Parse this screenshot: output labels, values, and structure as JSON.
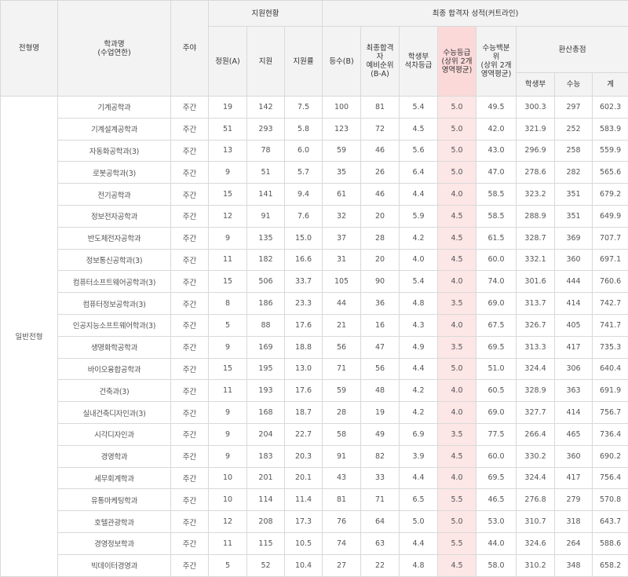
{
  "headers": {
    "type": "전형명",
    "major": "학과명\n(수업연한)",
    "schedule": "주야",
    "apply_group": "지원현황",
    "result_group": "최종 합격자 성적(커트라인)",
    "quota": "정원(A)",
    "applicants": "지원",
    "ratio": "지원률",
    "rank": "등수(B)",
    "waitlist": "최종합격\n자\n예비순위\n(B-A)",
    "school_grade": "학생부\n석차등급",
    "csat_grade": "수능등급\n(상위 2개\n영역평균)",
    "csat_pct": "수능백분\n위\n(상위 2개\n영역평균)",
    "conv_group": "환산총점",
    "conv_school": "학생부",
    "conv_csat": "수능",
    "conv_total": "계"
  },
  "admission_type": "일반전형",
  "rows": [
    {
      "major": "기계공학과",
      "schedule": "주간",
      "quota": "19",
      "applicants": "142",
      "ratio": "7.5",
      "rank": "100",
      "waitlist": "81",
      "school_grade": "5.4",
      "csat_grade": "5.0",
      "csat_pct": "49.5",
      "conv_school": "300.3",
      "conv_csat": "297",
      "conv_total": "602.3"
    },
    {
      "major": "기계설계공학과",
      "schedule": "주간",
      "quota": "51",
      "applicants": "293",
      "ratio": "5.8",
      "rank": "123",
      "waitlist": "72",
      "school_grade": "4.5",
      "csat_grade": "5.0",
      "csat_pct": "42.0",
      "conv_school": "321.9",
      "conv_csat": "252",
      "conv_total": "583.9"
    },
    {
      "major": "자동화공학과(3)",
      "schedule": "주간",
      "quota": "13",
      "applicants": "78",
      "ratio": "6.0",
      "rank": "59",
      "waitlist": "46",
      "school_grade": "5.6",
      "csat_grade": "5.0",
      "csat_pct": "43.0",
      "conv_school": "296.9",
      "conv_csat": "258",
      "conv_total": "559.9"
    },
    {
      "major": "로봇공학과(3)",
      "schedule": "주간",
      "quota": "9",
      "applicants": "51",
      "ratio": "5.7",
      "rank": "35",
      "waitlist": "26",
      "school_grade": "6.4",
      "csat_grade": "5.0",
      "csat_pct": "47.0",
      "conv_school": "278.6",
      "conv_csat": "282",
      "conv_total": "565.6"
    },
    {
      "major": "전기공학과",
      "schedule": "주간",
      "quota": "15",
      "applicants": "141",
      "ratio": "9.4",
      "rank": "61",
      "waitlist": "46",
      "school_grade": "4.4",
      "csat_grade": "4.0",
      "csat_pct": "58.5",
      "conv_school": "323.2",
      "conv_csat": "351",
      "conv_total": "679.2"
    },
    {
      "major": "정보전자공학과",
      "schedule": "주간",
      "quota": "12",
      "applicants": "91",
      "ratio": "7.6",
      "rank": "32",
      "waitlist": "20",
      "school_grade": "5.9",
      "csat_grade": "4.5",
      "csat_pct": "58.5",
      "conv_school": "288.9",
      "conv_csat": "351",
      "conv_total": "649.9"
    },
    {
      "major": "반도체전자공학과",
      "schedule": "주간",
      "quota": "9",
      "applicants": "135",
      "ratio": "15.0",
      "rank": "37",
      "waitlist": "28",
      "school_grade": "4.2",
      "csat_grade": "4.5",
      "csat_pct": "61.5",
      "conv_school": "328.7",
      "conv_csat": "369",
      "conv_total": "707.7"
    },
    {
      "major": "정보통신공학과(3)",
      "schedule": "주간",
      "quota": "11",
      "applicants": "182",
      "ratio": "16.6",
      "rank": "31",
      "waitlist": "20",
      "school_grade": "4.0",
      "csat_grade": "4.5",
      "csat_pct": "60.0",
      "conv_school": "332.1",
      "conv_csat": "360",
      "conv_total": "697.1"
    },
    {
      "major": "컴퓨터소프트웨어공학과(3)",
      "schedule": "주간",
      "quota": "15",
      "applicants": "506",
      "ratio": "33.7",
      "rank": "105",
      "waitlist": "90",
      "school_grade": "5.4",
      "csat_grade": "4.0",
      "csat_pct": "74.0",
      "conv_school": "301.6",
      "conv_csat": "444",
      "conv_total": "760.6"
    },
    {
      "major": "컴퓨터정보공학과(3)",
      "schedule": "주간",
      "quota": "8",
      "applicants": "186",
      "ratio": "23.3",
      "rank": "44",
      "waitlist": "36",
      "school_grade": "4.8",
      "csat_grade": "3.5",
      "csat_pct": "69.0",
      "conv_school": "313.7",
      "conv_csat": "414",
      "conv_total": "742.7"
    },
    {
      "major": "인공지능소프트웨어학과(3)",
      "schedule": "주간",
      "quota": "5",
      "applicants": "88",
      "ratio": "17.6",
      "rank": "21",
      "waitlist": "16",
      "school_grade": "4.3",
      "csat_grade": "4.0",
      "csat_pct": "67.5",
      "conv_school": "326.7",
      "conv_csat": "405",
      "conv_total": "741.7"
    },
    {
      "major": "생명화학공학과",
      "schedule": "주간",
      "quota": "9",
      "applicants": "169",
      "ratio": "18.8",
      "rank": "56",
      "waitlist": "47",
      "school_grade": "4.9",
      "csat_grade": "3.5",
      "csat_pct": "69.5",
      "conv_school": "313.3",
      "conv_csat": "417",
      "conv_total": "735.3"
    },
    {
      "major": "바이오융합공학과",
      "schedule": "주간",
      "quota": "15",
      "applicants": "195",
      "ratio": "13.0",
      "rank": "71",
      "waitlist": "56",
      "school_grade": "4.4",
      "csat_grade": "5.0",
      "csat_pct": "51.0",
      "conv_school": "324.4",
      "conv_csat": "306",
      "conv_total": "640.4"
    },
    {
      "major": "건축과(3)",
      "schedule": "주간",
      "quota": "11",
      "applicants": "193",
      "ratio": "17.6",
      "rank": "59",
      "waitlist": "48",
      "school_grade": "4.2",
      "csat_grade": "4.0",
      "csat_pct": "60.5",
      "conv_school": "328.9",
      "conv_csat": "363",
      "conv_total": "691.9"
    },
    {
      "major": "실내건축디자인과(3)",
      "schedule": "주간",
      "quota": "9",
      "applicants": "168",
      "ratio": "18.7",
      "rank": "28",
      "waitlist": "19",
      "school_grade": "4.2",
      "csat_grade": "4.0",
      "csat_pct": "69.0",
      "conv_school": "327.7",
      "conv_csat": "414",
      "conv_total": "756.7"
    },
    {
      "major": "시각디자인과",
      "schedule": "주간",
      "quota": "9",
      "applicants": "204",
      "ratio": "22.7",
      "rank": "58",
      "waitlist": "49",
      "school_grade": "6.9",
      "csat_grade": "3.5",
      "csat_pct": "77.5",
      "conv_school": "266.4",
      "conv_csat": "465",
      "conv_total": "736.4"
    },
    {
      "major": "경영학과",
      "schedule": "주간",
      "quota": "9",
      "applicants": "183",
      "ratio": "20.3",
      "rank": "91",
      "waitlist": "82",
      "school_grade": "3.9",
      "csat_grade": "4.5",
      "csat_pct": "60.0",
      "conv_school": "330.2",
      "conv_csat": "360",
      "conv_total": "690.2"
    },
    {
      "major": "세무회계학과",
      "schedule": "주간",
      "quota": "10",
      "applicants": "201",
      "ratio": "20.1",
      "rank": "43",
      "waitlist": "33",
      "school_grade": "4.4",
      "csat_grade": "4.0",
      "csat_pct": "69.5",
      "conv_school": "324.4",
      "conv_csat": "417",
      "conv_total": "756.4"
    },
    {
      "major": "유통마케팅학과",
      "schedule": "주간",
      "quota": "10",
      "applicants": "114",
      "ratio": "11.4",
      "rank": "81",
      "waitlist": "71",
      "school_grade": "6.5",
      "csat_grade": "5.5",
      "csat_pct": "46.5",
      "conv_school": "276.8",
      "conv_csat": "279",
      "conv_total": "570.8"
    },
    {
      "major": "호텔관광학과",
      "schedule": "주간",
      "quota": "12",
      "applicants": "208",
      "ratio": "17.3",
      "rank": "76",
      "waitlist": "64",
      "school_grade": "5.0",
      "csat_grade": "5.0",
      "csat_pct": "53.0",
      "conv_school": "310.7",
      "conv_csat": "318",
      "conv_total": "643.7"
    },
    {
      "major": "경영정보학과",
      "schedule": "주간",
      "quota": "11",
      "applicants": "115",
      "ratio": "10.5",
      "rank": "74",
      "waitlist": "63",
      "school_grade": "4.4",
      "csat_grade": "5.5",
      "csat_pct": "44.0",
      "conv_school": "324.6",
      "conv_csat": "264",
      "conv_total": "588.6"
    },
    {
      "major": "빅데이터경영과",
      "schedule": "주간",
      "quota": "5",
      "applicants": "52",
      "ratio": "10.4",
      "rank": "27",
      "waitlist": "22",
      "school_grade": "4.8",
      "csat_grade": "4.5",
      "csat_pct": "58.0",
      "conv_school": "310.2",
      "conv_csat": "348",
      "conv_total": "658.2"
    }
  ]
}
